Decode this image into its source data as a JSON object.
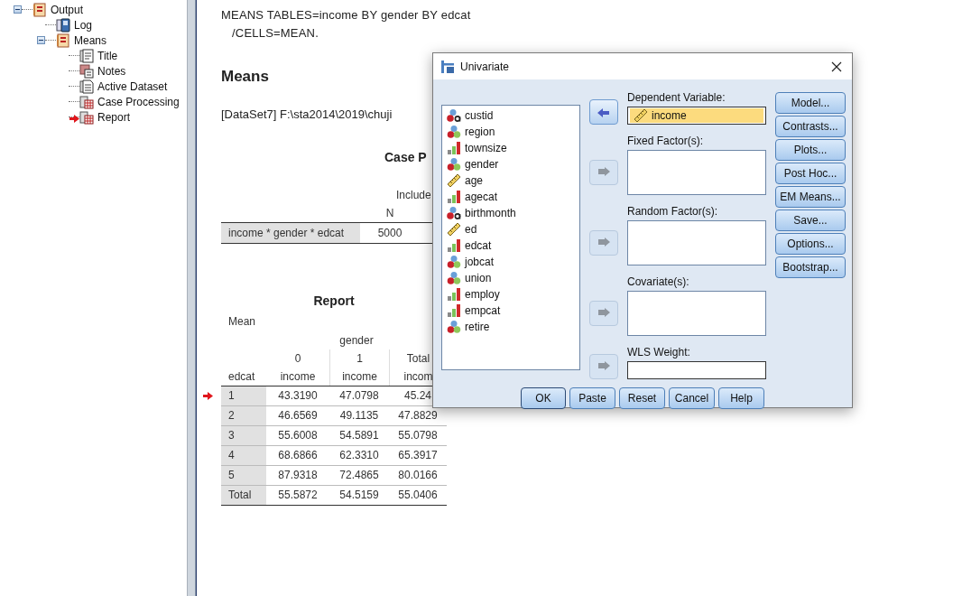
{
  "tree": {
    "items": [
      {
        "label": "Output",
        "kind": "heading",
        "expanded": true,
        "current": false,
        "children": [
          {
            "label": "Log",
            "kind": "log",
            "current": false
          },
          {
            "label": "Means",
            "kind": "heading",
            "expanded": true,
            "current": false,
            "children": [
              {
                "label": "Title",
                "kind": "title",
                "current": false
              },
              {
                "label": "Notes",
                "kind": "notes",
                "current": false
              },
              {
                "label": "Active Dataset",
                "kind": "text",
                "current": false
              },
              {
                "label": "Case Processing",
                "kind": "table",
                "current": false
              },
              {
                "label": "Report",
                "kind": "table",
                "current": true
              }
            ]
          }
        ]
      }
    ]
  },
  "output": {
    "syntax": [
      "MEANS TABLES=income BY gender BY edcat",
      "/CELLS=MEAN."
    ],
    "heading": "Means",
    "dataset_line": "[DataSet7] F:\\sta2014\\2019\\chuji",
    "case_processing": {
      "title": "Case P",
      "group_header": "Include",
      "columns": [
        "N"
      ],
      "rows": [
        {
          "label": "income * gender * edcat",
          "values": [
            "5000"
          ]
        }
      ]
    },
    "report": {
      "title": "Report",
      "statistic": "Mean",
      "group_header": "gender",
      "column_values": [
        "0",
        "1",
        "Total"
      ],
      "row_header": "edcat",
      "column_measures": [
        "income",
        "income",
        "incom"
      ],
      "rows": [
        {
          "label": "1",
          "values": [
            "43.3190",
            "47.0798",
            "45.24"
          ],
          "current": true
        },
        {
          "label": "2",
          "values": [
            "46.6569",
            "49.1135",
            "47.8829"
          ],
          "current": false
        },
        {
          "label": "3",
          "values": [
            "55.6008",
            "54.5891",
            "55.0798"
          ],
          "current": false
        },
        {
          "label": "4",
          "values": [
            "68.6866",
            "62.3310",
            "65.3917"
          ],
          "current": false
        },
        {
          "label": "5",
          "values": [
            "87.9318",
            "72.4865",
            "80.0166"
          ],
          "current": false
        },
        {
          "label": "Total",
          "values": [
            "55.5872",
            "54.5159",
            "55.0406"
          ],
          "current": false
        }
      ]
    }
  },
  "dialog": {
    "title": "Univariate",
    "variables": [
      {
        "name": "custid",
        "kind": "string"
      },
      {
        "name": "region",
        "kind": "nominal"
      },
      {
        "name": "townsize",
        "kind": "ordinal"
      },
      {
        "name": "gender",
        "kind": "nominal"
      },
      {
        "name": "age",
        "kind": "scale"
      },
      {
        "name": "agecat",
        "kind": "ordinal"
      },
      {
        "name": "birthmonth",
        "kind": "string"
      },
      {
        "name": "ed",
        "kind": "scale"
      },
      {
        "name": "edcat",
        "kind": "ordinal"
      },
      {
        "name": "jobcat",
        "kind": "nominal"
      },
      {
        "name": "union",
        "kind": "nominal"
      },
      {
        "name": "employ",
        "kind": "ordinal"
      },
      {
        "name": "empcat",
        "kind": "ordinal"
      },
      {
        "name": "retire",
        "kind": "nominal"
      }
    ],
    "targets": [
      {
        "label": "Dependent Variable:",
        "kind": "field",
        "arrow": {
          "kind": "left",
          "disabled": false
        },
        "items": [
          {
            "name": "income",
            "kind": "scale",
            "selected": true
          }
        ]
      },
      {
        "label": "Fixed Factor(s):",
        "kind": "box",
        "arrow": {
          "kind": "right",
          "disabled": true
        }
      },
      {
        "label": "Random Factor(s):",
        "kind": "box",
        "arrow": {
          "kind": "right",
          "disabled": true
        }
      },
      {
        "label": "Covariate(s):",
        "kind": "box",
        "arrow": {
          "kind": "right",
          "disabled": true
        }
      },
      {
        "label": "WLS Weight:",
        "kind": "field",
        "arrow": {
          "kind": "right",
          "disabled": true
        }
      }
    ],
    "side_buttons": [
      "Model...",
      "Contrasts...",
      "Plots...",
      "Post Hoc...",
      "EM Means...",
      "Save...",
      "Options...",
      "Bootstrap..."
    ],
    "buttons": [
      {
        "label": "OK",
        "default": true
      },
      {
        "label": "Paste",
        "default": false
      },
      {
        "label": "Reset",
        "default": false
      },
      {
        "label": "Cancel",
        "default": false
      },
      {
        "label": "Help",
        "default": false
      }
    ]
  }
}
